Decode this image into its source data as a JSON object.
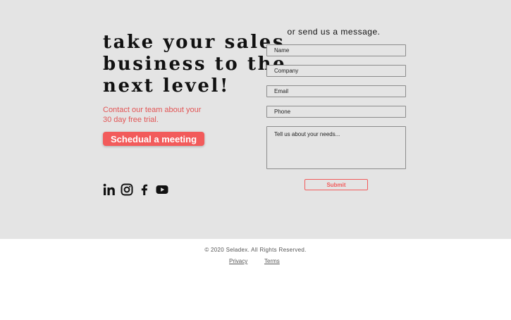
{
  "hero": {
    "headline_lines": [
      "take your sales",
      "business to the",
      "next level!"
    ],
    "subtext_lines": [
      "Contact our team about your",
      "30 day free trial."
    ],
    "cta_label": "Schedual a meeting",
    "accent_color": "#f25b5b",
    "background_color": "#e4e4e4",
    "social_icons": [
      "linkedin-icon",
      "instagram-icon",
      "facebook-icon",
      "youtube-icon"
    ]
  },
  "form": {
    "heading": "or send us a message.",
    "name_placeholder": "Name",
    "company_placeholder": "Company",
    "email_placeholder": "Email",
    "phone_placeholder": "Phone",
    "message_placeholder": "Tell us about your needs...",
    "submit_label": "Submit"
  },
  "footer": {
    "copyright": "© 2020 Seladex. All Rights Reserved.",
    "privacy_label": "Privacy",
    "terms_label": "Terms"
  }
}
